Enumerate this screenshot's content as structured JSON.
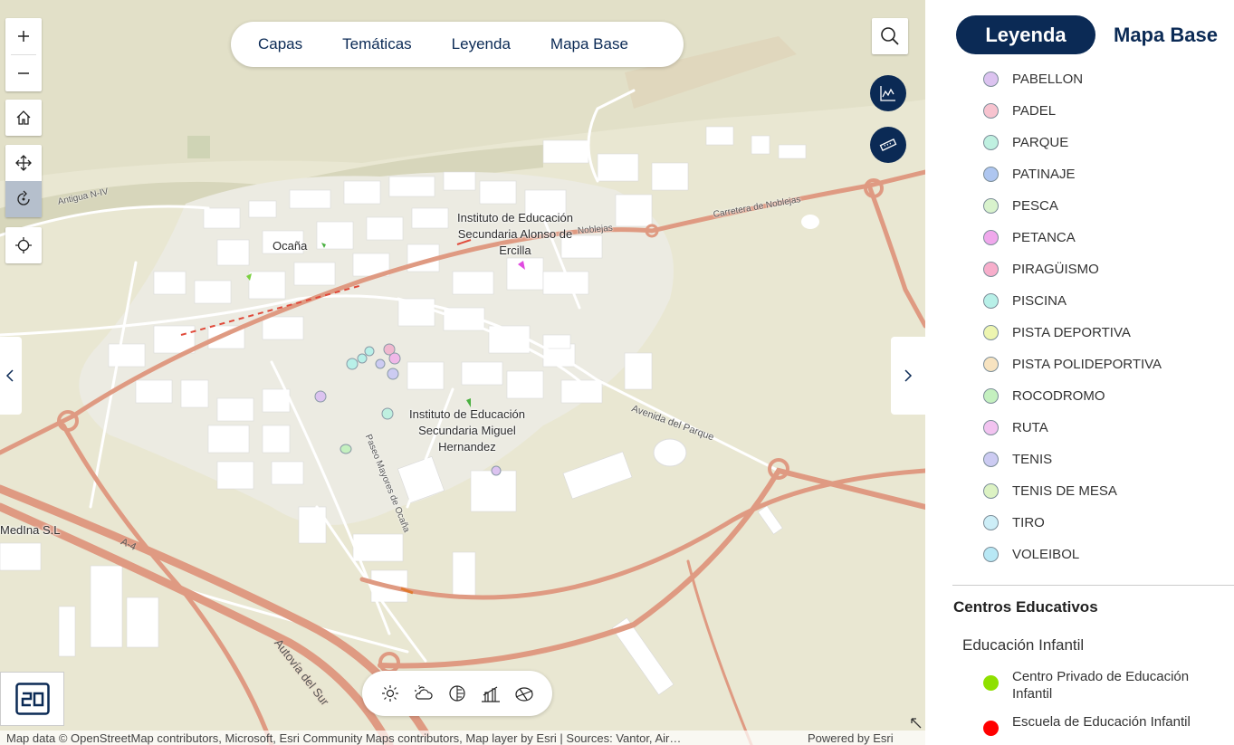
{
  "colors": {
    "brand_navy": "#0b2a55",
    "map_background": "#e9e7d2",
    "highway": "#df9a82",
    "road": "#ffffff"
  },
  "map": {
    "top_nav": [
      "Capas",
      "Temáticas",
      "Leyenda",
      "Mapa Base"
    ],
    "zoom_controls": [
      "zoom-in-icon",
      "zoom-out-icon"
    ],
    "nav_controls": [
      "home-icon",
      "pan-icon",
      "rotate-icon",
      "locate-icon"
    ],
    "right_tools": [
      "search-icon",
      "elevation-profile-icon",
      "measure-icon"
    ],
    "bottom_tools": [
      "daylight-icon",
      "weather-icon",
      "shadow-cast-icon",
      "line-of-sight-icon",
      "slice-icon"
    ],
    "view_toggle": "2D",
    "place_labels": {
      "ocana": "Ocaña",
      "ies_alonso": "Instituto de Educación\nSecundaria Alonso de\nErcilla",
      "ies_miguel": "Instituto de Educación\nSecundaria Miguel\nHernandez",
      "medina": "MedIna S.L"
    },
    "road_labels": {
      "antigua": "Antigua N-IV",
      "carretera": "Carretera de Noblejas",
      "noblejas": "Noblejas",
      "avenida": "Avenida del Parque",
      "autovia": "Autovía del Sur",
      "a4": "A-4",
      "paseo": "Paseo Mayores de Ocaña"
    },
    "attribution": "Map data © OpenStreetMap contributors, Microsoft, Esri Community Maps contributors, Map layer by Esri | Sources: Vantor, Air…",
    "powered_by": "Powered by Esri"
  },
  "panel": {
    "tabs": {
      "active": "Leyenda",
      "inactive": "Mapa Base"
    },
    "legend_items": [
      {
        "label": "PABELLON",
        "color": "#dcc3f0"
      },
      {
        "label": "PADEL",
        "color": "#f7c3cf"
      },
      {
        "label": "PARQUE",
        "color": "#bff0e0"
      },
      {
        "label": "PATINAJE",
        "color": "#aec6f0"
      },
      {
        "label": "PESCA",
        "color": "#d8f2cc"
      },
      {
        "label": "PETANCA",
        "color": "#f0a8ec"
      },
      {
        "label": "PIRAGÜISMO",
        "color": "#f7aecb"
      },
      {
        "label": "PISCINA",
        "color": "#b8f0e8"
      },
      {
        "label": "PISTA DEPORTIVA",
        "color": "#edf5b0"
      },
      {
        "label": "PISTA POLIDEPORTIVA",
        "color": "#f7e3c0"
      },
      {
        "label": "ROCODROMO",
        "color": "#c4f0bf"
      },
      {
        "label": "RUTA",
        "color": "#f2c3f0"
      },
      {
        "label": "TENIS",
        "color": "#cccbf2"
      },
      {
        "label": "TENIS DE MESA",
        "color": "#dcf2c3"
      },
      {
        "label": "TIRO",
        "color": "#cdeef7"
      },
      {
        "label": "VOLEIBOL",
        "color": "#b8e8f5"
      }
    ],
    "section_title": "Centros Educativos",
    "subsection_title": "Educación Infantil",
    "education_items": [
      {
        "label": "Centro Privado de Educación Infantil",
        "color": "#8fe000"
      },
      {
        "label": "Escuela de Educación Infantil",
        "color": "#ff0000"
      }
    ]
  }
}
